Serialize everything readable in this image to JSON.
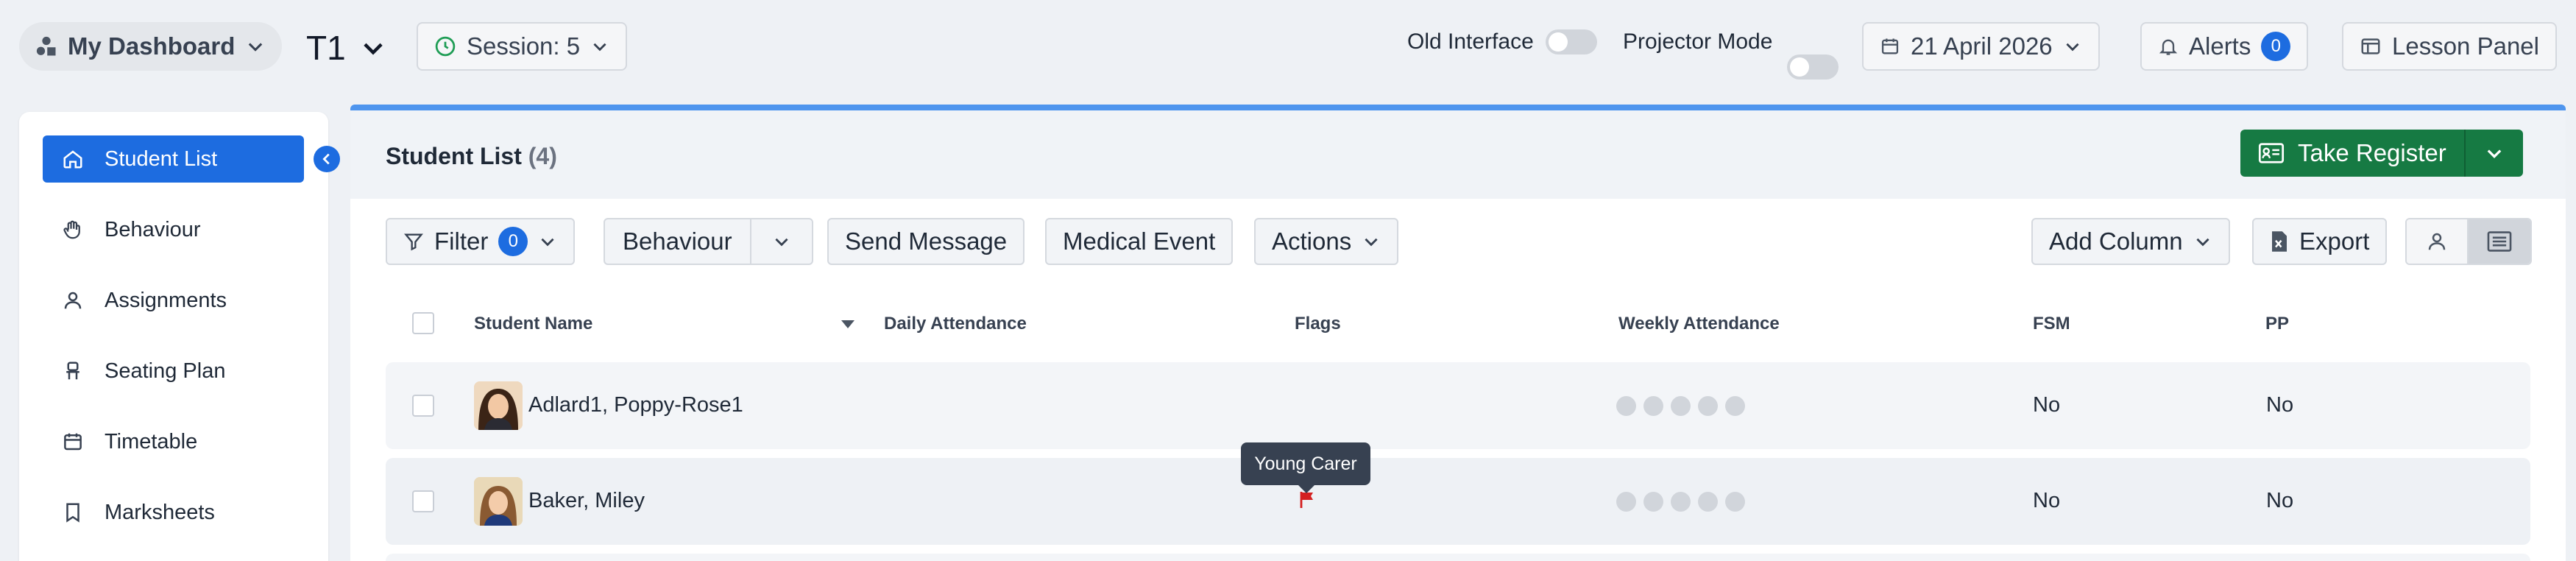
{
  "topbar": {
    "dashboard_label": "My Dashboard",
    "term_label": "T1",
    "session_label": "Session: 5",
    "old_interface_label": "Old Interface",
    "projector_mode_label": "Projector Mode",
    "date_label": "21 April 2026",
    "alerts_label": "Alerts",
    "alerts_count": "0",
    "lesson_panel_label": "Lesson Panel"
  },
  "sidebar": {
    "items": [
      {
        "label": "Student List",
        "icon": "home-icon",
        "active": true
      },
      {
        "label": "Behaviour",
        "icon": "hand-icon",
        "active": false
      },
      {
        "label": "Assignments",
        "icon": "user-icon",
        "active": false
      },
      {
        "label": "Seating Plan",
        "icon": "chair-icon",
        "active": false
      },
      {
        "label": "Timetable",
        "icon": "calendar-icon",
        "active": false
      },
      {
        "label": "Marksheets",
        "icon": "bookmark-icon",
        "active": false
      }
    ]
  },
  "main": {
    "title": "Student List",
    "count": "(4)",
    "take_register_label": "Take Register",
    "toolbar": {
      "filter_label": "Filter",
      "filter_count": "0",
      "behaviour_label": "Behaviour",
      "send_message_label": "Send Message",
      "medical_event_label": "Medical Event",
      "actions_label": "Actions",
      "add_column_label": "Add Column",
      "export_label": "Export"
    },
    "columns": [
      "Student Name",
      "Daily Attendance",
      "Flags",
      "Weekly Attendance",
      "FSM",
      "PP"
    ],
    "rows": [
      {
        "name": "Adlard1, Poppy-Rose1",
        "fsm": "No",
        "pp": "No"
      },
      {
        "name": "Baker, Miley",
        "fsm": "No",
        "pp": "No"
      }
    ],
    "tooltip": "Young Carer"
  },
  "colors": {
    "accent_blue": "#1d6ce0",
    "register_green": "#167a43",
    "flag_red": "#d42020",
    "header_bar": "#4e95ee"
  }
}
